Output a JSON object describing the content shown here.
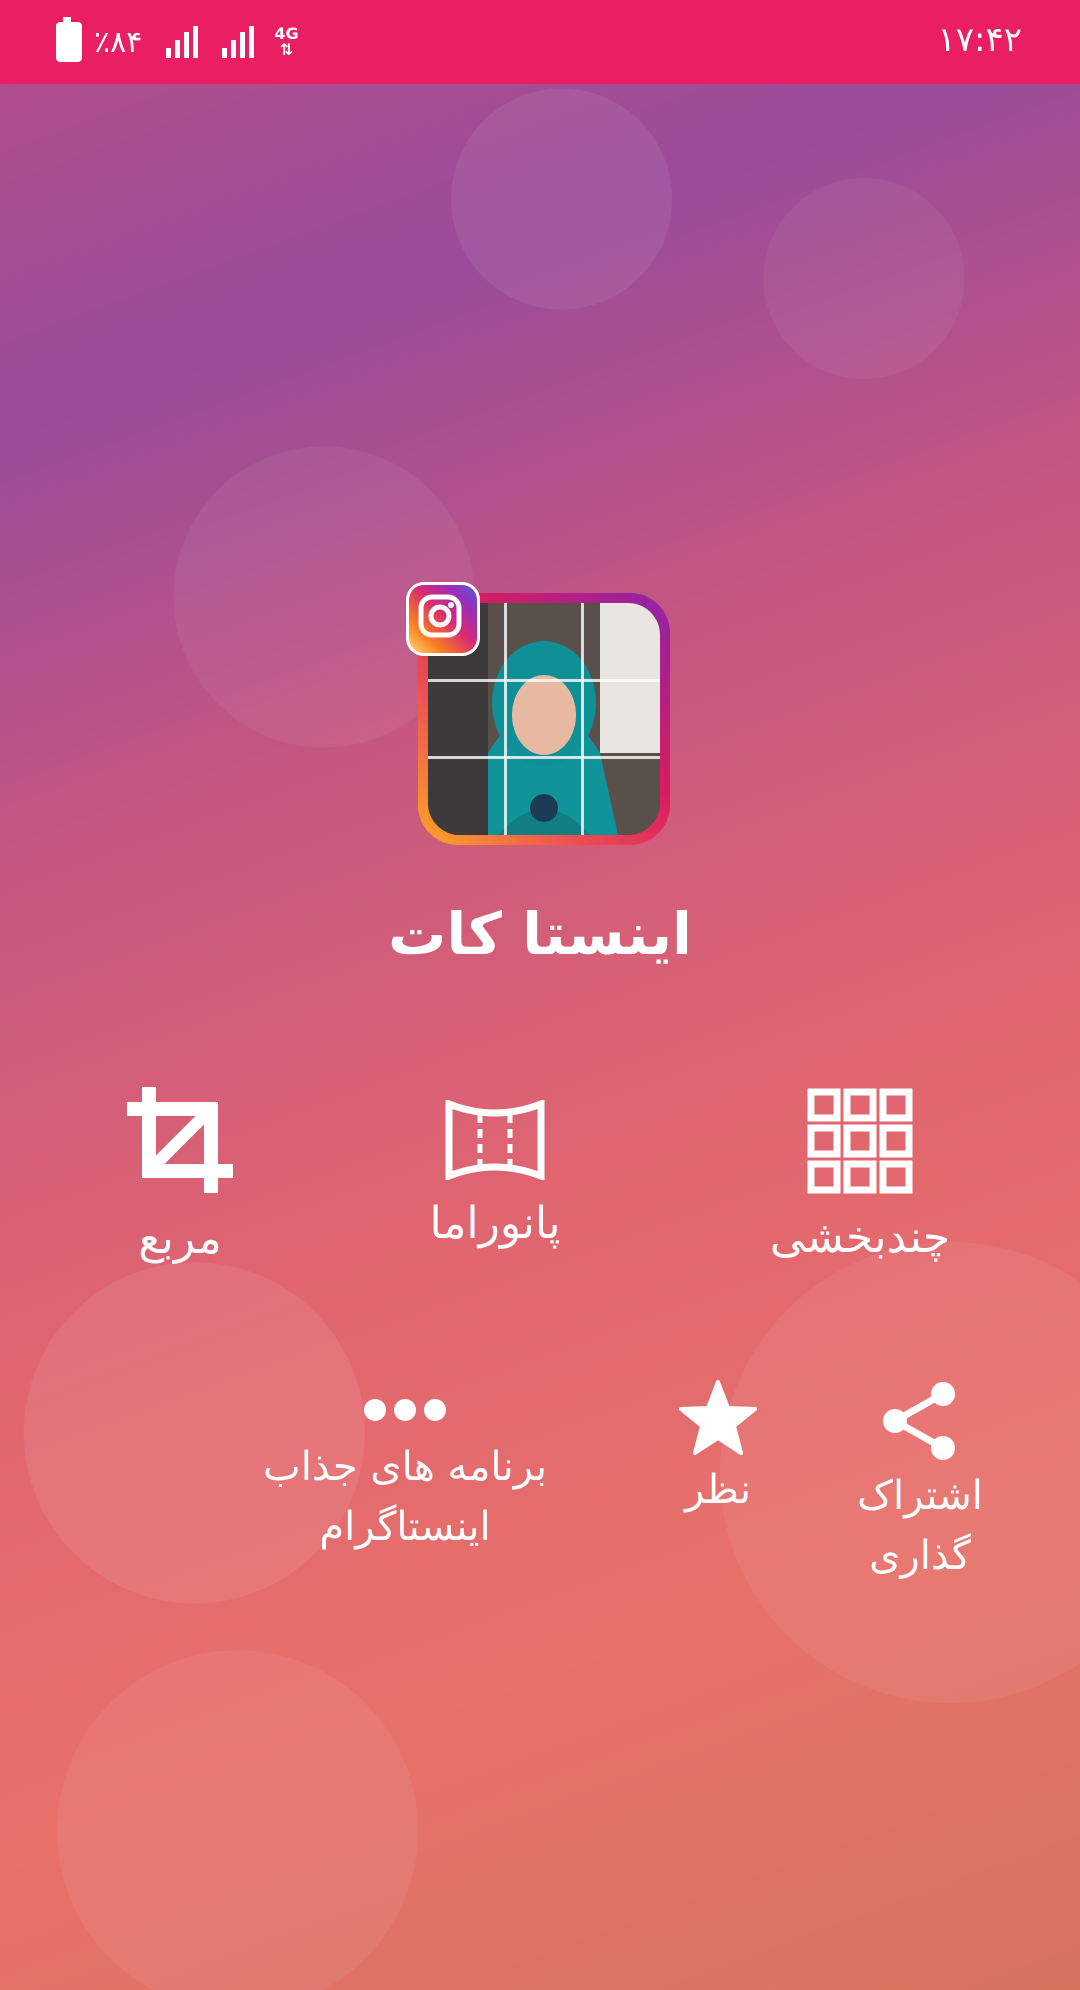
{
  "status_bar": {
    "time": "۱۷:۴۲",
    "battery": "٪۸۴",
    "network": "4G",
    "color": "#e91e63"
  },
  "app": {
    "title": "اینستا کات",
    "logo_icon": "instagram-icon"
  },
  "tools": [
    {
      "label": "مربع",
      "icon": "crop-icon"
    },
    {
      "label": "پانوراما",
      "icon": "panorama-icon"
    },
    {
      "label": "چندبخشی",
      "icon": "grid-icon"
    }
  ],
  "actions": [
    {
      "label_line1": "برنامه های جذاب",
      "label_line2": "اینستاگرام",
      "icon": "more-dots-icon"
    },
    {
      "label_line1": "نظر",
      "icon": "star-icon"
    },
    {
      "label_line1": "اشتراک",
      "label_line2": "گذاری",
      "icon": "share-icon"
    }
  ]
}
